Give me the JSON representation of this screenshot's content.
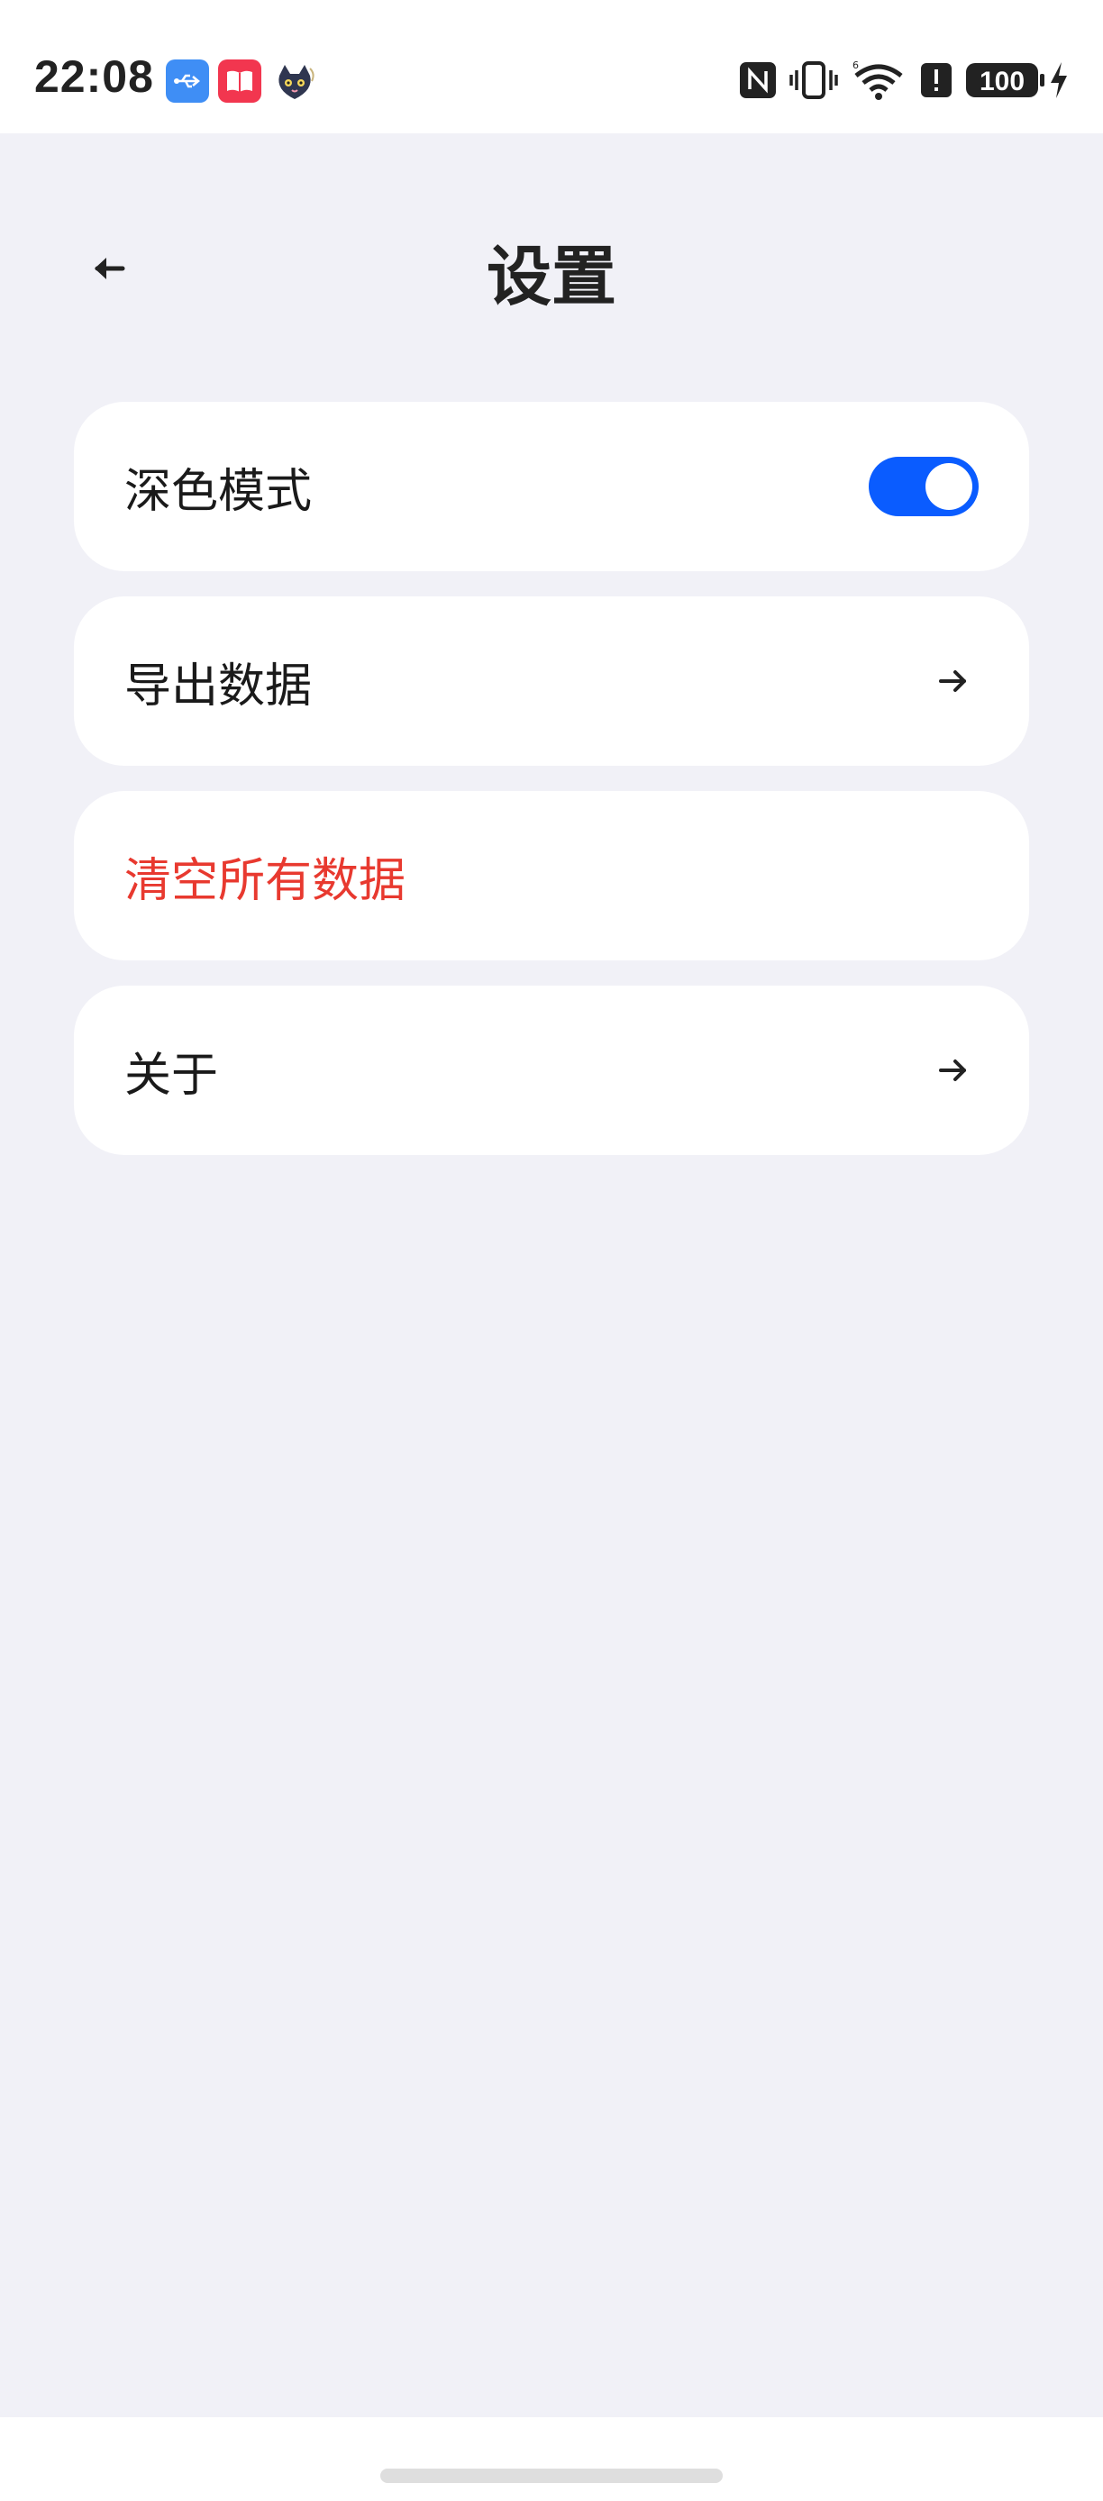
{
  "status_bar": {
    "time": "22:08",
    "battery": "100",
    "icons": [
      "usb-icon",
      "book-app-icon",
      "cat-app-icon",
      "nfc-icon",
      "vibrate-icon",
      "wifi-icon",
      "alert-icon",
      "battery-icon",
      "charging-icon"
    ]
  },
  "header": {
    "title": "设置",
    "back_icon": "back-arrow-icon"
  },
  "settings": {
    "dark_mode": {
      "label": "深色模式",
      "enabled": true
    },
    "export": {
      "label": "导出数据",
      "icon": "arrow-right-icon"
    },
    "clear": {
      "label": "清空所有数据",
      "color": "#e8392f"
    },
    "about": {
      "label": "关于",
      "icon": "arrow-right-icon"
    }
  },
  "colors": {
    "accent": "#0a5cff",
    "background": "#f1f1f7",
    "danger": "#e8392f"
  }
}
